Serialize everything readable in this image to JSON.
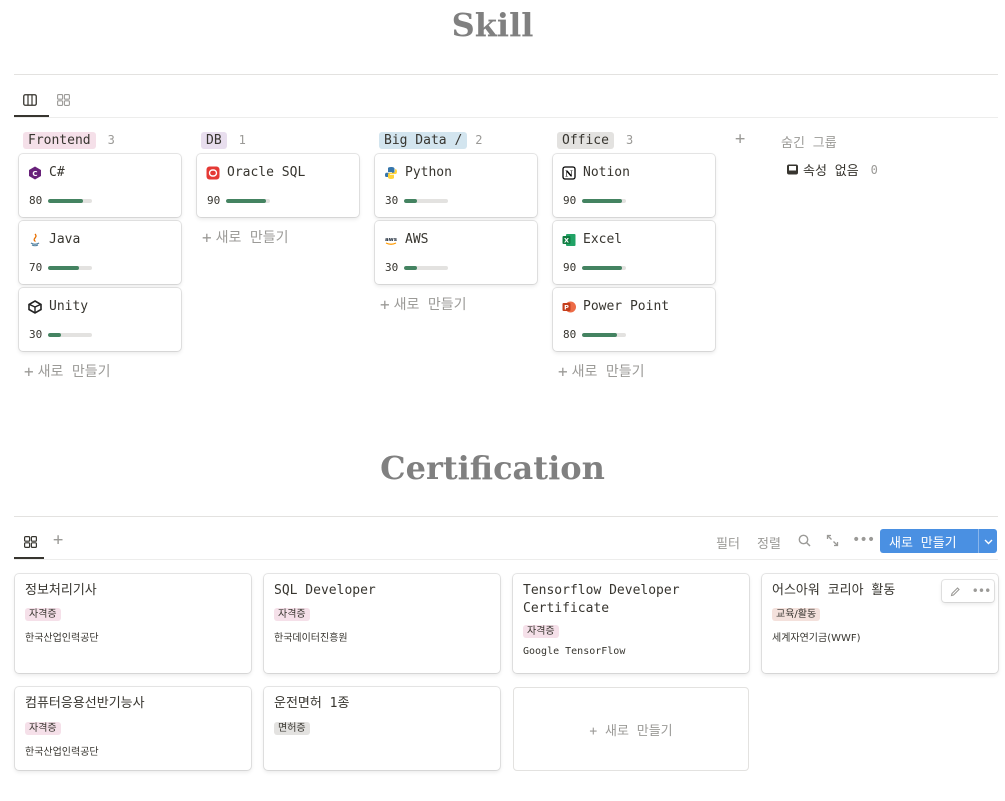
{
  "skill": {
    "title": "Skill",
    "columns": [
      {
        "tag": "Frontend",
        "tag_color": "#f5e0e9",
        "count": "3",
        "cards": [
          {
            "name": "C#",
            "icon": "csharp-icon",
            "value": "80",
            "percent": 80
          },
          {
            "name": "Java",
            "icon": "java-icon",
            "value": "70",
            "percent": 70
          },
          {
            "name": "Unity",
            "icon": "unity-icon",
            "value": "30",
            "percent": 30
          }
        ],
        "new_label": "새로 만들기"
      },
      {
        "tag": "DB",
        "tag_color": "#e8deee",
        "count": "1",
        "cards": [
          {
            "name": "Oracle SQL",
            "icon": "oracle-icon",
            "value": "90",
            "percent": 90
          }
        ],
        "new_label": "새로 만들기"
      },
      {
        "tag": "Big Data /",
        "tag_color": "#d3e5ef",
        "count": "2",
        "cards": [
          {
            "name": "Python",
            "icon": "python-icon",
            "value": "30",
            "percent": 30
          },
          {
            "name": "AWS",
            "icon": "aws-icon",
            "value": "30",
            "percent": 30
          }
        ],
        "new_label": "새로 만들기"
      },
      {
        "tag": "Office",
        "tag_color": "#e3e2e0",
        "count": "3",
        "cards": [
          {
            "name": "Notion",
            "icon": "notion-icon",
            "value": "90",
            "percent": 90
          },
          {
            "name": "Excel",
            "icon": "excel-icon",
            "value": "90",
            "percent": 90
          },
          {
            "name": "Power Point",
            "icon": "powerpoint-icon",
            "value": "80",
            "percent": 80
          }
        ],
        "new_label": "새로 만들기"
      }
    ],
    "hidden_groups_label": "숨긴 그룹",
    "no_property_label": "속성 없음",
    "no_property_count": "0",
    "add_group": "+"
  },
  "cert": {
    "title": "Certification",
    "toolbar": {
      "filter": "필터",
      "sort": "정렬",
      "new_button": "새로 만들기",
      "add_view": "+"
    },
    "cards": [
      {
        "title": "정보처리기사",
        "tag": "자격증",
        "tag_color": "#f5e0e9",
        "org": "한국산업인력공단"
      },
      {
        "title": "SQL Developer",
        "tag": "자격증",
        "tag_color": "#f5e0e9",
        "org": "한국데이터진흥원"
      },
      {
        "title": "Tensorflow Developer Certificate",
        "tag": "자격증",
        "tag_color": "#f5e0e9",
        "org": "Google TensorFlow"
      },
      {
        "title": "어스아워 코리아 활동",
        "tag": "교육/활동",
        "tag_color": "#f4e1dc",
        "org": "세계자연기금(WWF)"
      },
      {
        "title": "컴퓨터응용선반기능사",
        "tag": "자격증",
        "tag_color": "#f5e0e9",
        "org": "한국산업인력공단"
      },
      {
        "title": "운전면허 1종",
        "tag": "면허증",
        "tag_color": "#e3e2e0",
        "org": ""
      }
    ],
    "new_card_label": "+ 새로 만들기"
  }
}
